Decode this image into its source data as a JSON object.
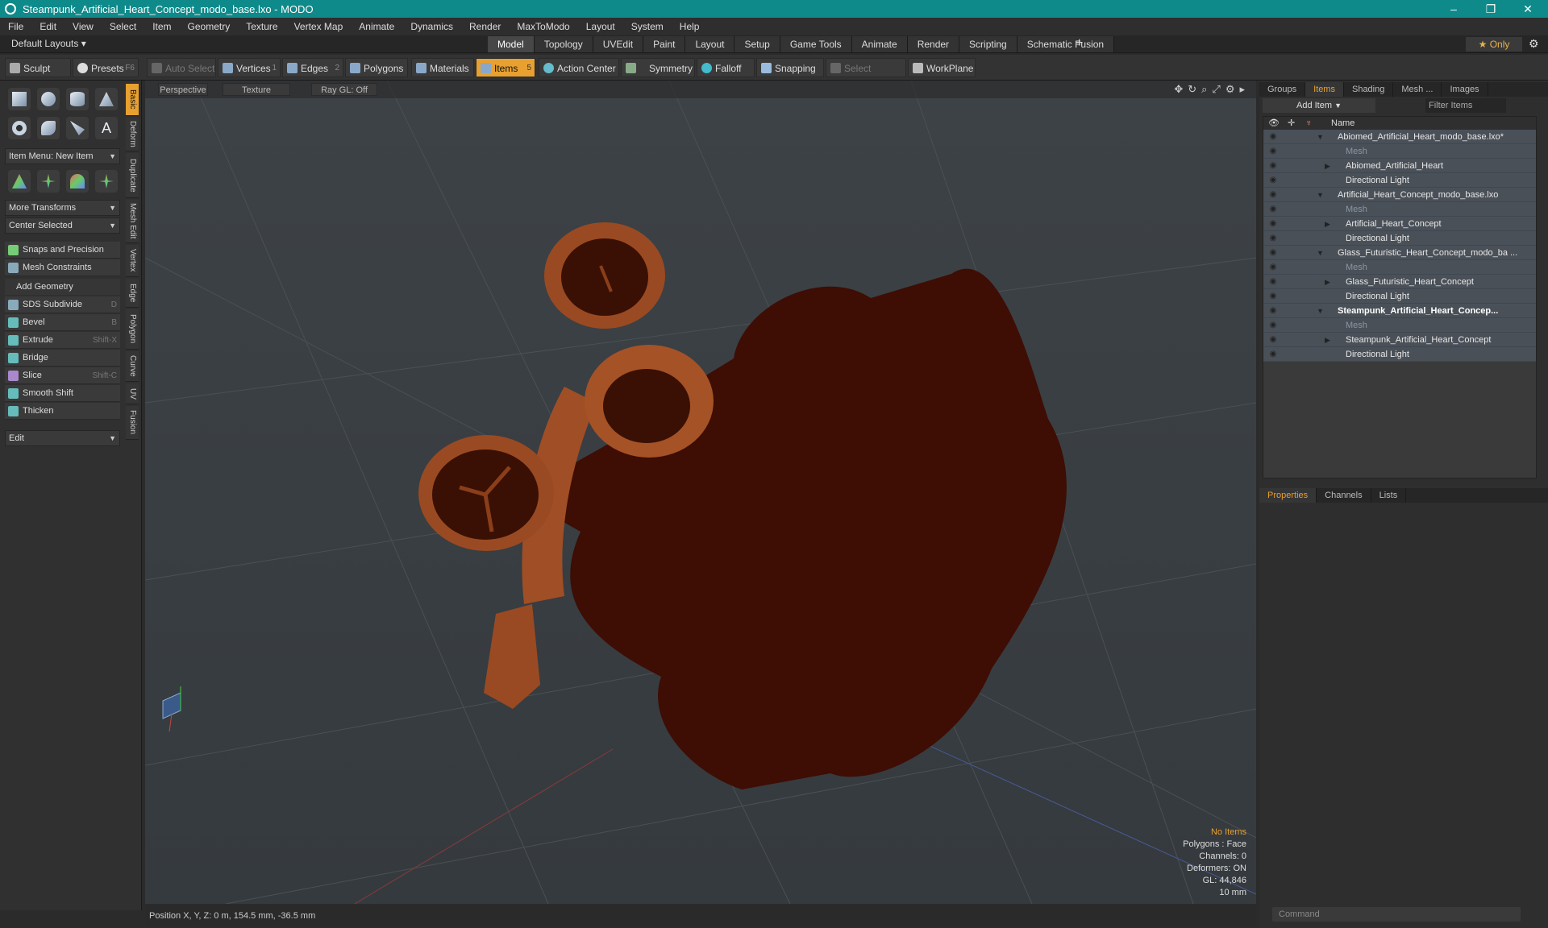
{
  "window": {
    "title": "Steampunk_Artificial_Heart_Concept_modo_base.lxo - MODO",
    "minimize": "–",
    "maximize": "❐",
    "close": "✕"
  },
  "menu": [
    "File",
    "Edit",
    "View",
    "Select",
    "Item",
    "Geometry",
    "Texture",
    "Vertex Map",
    "Animate",
    "Dynamics",
    "Render",
    "MaxToModo",
    "Layout",
    "System",
    "Help"
  ],
  "layoutbar": {
    "default_layouts": "Default Layouts ▾",
    "tabs": [
      "Model",
      "Topology",
      "UVEdit",
      "Paint",
      "Layout",
      "Setup",
      "Game Tools",
      "Animate",
      "Render",
      "Scripting",
      "Schematic Fusion"
    ],
    "active_tab": "Model",
    "plus": "+",
    "only": "★ Only"
  },
  "toolbar": {
    "sculpt": "Sculpt",
    "presets": "Presets",
    "presets_key": "F6",
    "auto_select": "Auto Select",
    "vertices": "Vertices",
    "vertices_count": "1",
    "edges": "Edges",
    "edges_count": "2",
    "polygons": "Polygons",
    "materials": "Materials",
    "items": "Items",
    "items_count": "5",
    "action_center": "Action Center",
    "symmetry": "Symmetry",
    "falloff": "Falloff",
    "snapping": "Snapping",
    "select_through": "Select Through",
    "workplane": "WorkPlane"
  },
  "left": {
    "item_menu": "Item Menu: New Item",
    "more_transforms": "More Transforms",
    "center_selected": "Center Selected",
    "snaps": "Snaps and Precision",
    "mesh_constraints": "Mesh Constraints",
    "add_geometry": "Add Geometry",
    "tools": [
      {
        "label": "SDS Subdivide",
        "key": "D"
      },
      {
        "label": "Bevel",
        "key": "B"
      },
      {
        "label": "Extrude",
        "key": "Shift-X"
      },
      {
        "label": "Bridge",
        "key": ""
      },
      {
        "label": "Slice",
        "key": "Shift-C"
      },
      {
        "label": "Smooth Shift",
        "key": ""
      },
      {
        "label": "Thicken",
        "key": ""
      }
    ],
    "edit": "Edit",
    "vtabs": [
      "Basic",
      "Deform",
      "Duplicate",
      "Mesh Edit",
      "Vertex",
      "Edge",
      "Polygon",
      "Curve",
      "UV",
      "Fusion"
    ]
  },
  "viewport": {
    "view": "Perspective",
    "shading": "Texture",
    "raygl": "Ray GL: Off",
    "hud": {
      "no_items": "No Items",
      "polygons": "Polygons : Face",
      "channels": "Channels: 0",
      "deformers": "Deformers: ON",
      "gl": "GL: 44,846",
      "scale": "10 mm"
    }
  },
  "status": {
    "position": "Position X, Y, Z:  0 m, 154.5 mm, -36.5 mm"
  },
  "right": {
    "top_tabs": [
      "Groups",
      "Items",
      "Shading",
      "Mesh ...",
      "Images"
    ],
    "active_top": "Items",
    "add_item": "Add Item",
    "filter_items": "Filter Items",
    "name_col": "Name",
    "tree": [
      {
        "label": "Abiomed_Artificial_Heart_modo_base.lxo*",
        "level": 0,
        "expand": "▼",
        "dim": false,
        "bold": false
      },
      {
        "label": "Mesh",
        "level": 1,
        "expand": "",
        "dim": true,
        "bold": false
      },
      {
        "label": "Abiomed_Artificial_Heart",
        "level": 1,
        "expand": "▶",
        "dim": false,
        "bold": false
      },
      {
        "label": "Directional Light",
        "level": 1,
        "expand": "",
        "dim": false,
        "bold": false
      },
      {
        "label": "Artificial_Heart_Concept_modo_base.lxo",
        "level": 0,
        "expand": "▼",
        "dim": false,
        "bold": false
      },
      {
        "label": "Mesh",
        "level": 1,
        "expand": "",
        "dim": true,
        "bold": false
      },
      {
        "label": "Artificial_Heart_Concept",
        "level": 1,
        "expand": "▶",
        "dim": false,
        "bold": false
      },
      {
        "label": "Directional Light",
        "level": 1,
        "expand": "",
        "dim": false,
        "bold": false
      },
      {
        "label": "Glass_Futuristic_Heart_Concept_modo_ba ...",
        "level": 0,
        "expand": "▼",
        "dim": false,
        "bold": false
      },
      {
        "label": "Mesh",
        "level": 1,
        "expand": "",
        "dim": true,
        "bold": false
      },
      {
        "label": "Glass_Futuristic_Heart_Concept",
        "level": 1,
        "expand": "▶",
        "dim": false,
        "bold": false
      },
      {
        "label": "Directional Light",
        "level": 1,
        "expand": "",
        "dim": false,
        "bold": false
      },
      {
        "label": "Steampunk_Artificial_Heart_Concep...",
        "level": 0,
        "expand": "▼",
        "dim": false,
        "bold": true
      },
      {
        "label": "Mesh",
        "level": 1,
        "expand": "",
        "dim": true,
        "bold": false
      },
      {
        "label": "Steampunk_Artificial_Heart_Concept",
        "level": 1,
        "expand": "▶",
        "dim": false,
        "bold": false
      },
      {
        "label": "Directional Light",
        "level": 1,
        "expand": "",
        "dim": false,
        "bold": false
      }
    ],
    "bottom_tabs": [
      "Properties",
      "Channels",
      "Lists"
    ],
    "active_bottom": "Properties",
    "command": "Command"
  }
}
